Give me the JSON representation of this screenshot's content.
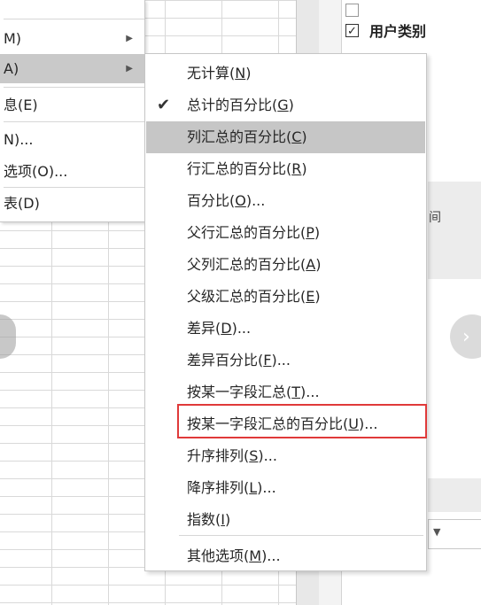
{
  "pane": {
    "fields": [
      {
        "label": "用户类别",
        "checked": true
      }
    ],
    "band_text": "间"
  },
  "parent_menu": {
    "items": [
      {
        "pre": "",
        "key": "",
        "post": "",
        "partial": "M)",
        "arrow": true
      },
      {
        "pre": "",
        "key": "",
        "post": "",
        "partial": "A)",
        "arrow": true,
        "highlighted": true
      },
      {
        "partial": "息(E)"
      },
      {
        "partial": "N)..."
      },
      {
        "partial": "选项(O)..."
      },
      {
        "partial": "表(D)"
      }
    ]
  },
  "submenu": {
    "items": [
      {
        "label_pre": "无计算(",
        "key": "N",
        "label_post": ")"
      },
      {
        "label_pre": "总计的百分比(",
        "key": "G",
        "label_post": ")",
        "checked": true
      },
      {
        "label_pre": "列汇总的百分比(",
        "key": "C",
        "label_post": ")",
        "highlighted": true
      },
      {
        "label_pre": "行汇总的百分比(",
        "key": "R",
        "label_post": ")"
      },
      {
        "label_pre": "百分比(",
        "key": "O",
        "label_post": ")..."
      },
      {
        "label_pre": "父行汇总的百分比(",
        "key": "P",
        "label_post": ")"
      },
      {
        "label_pre": "父列汇总的百分比(",
        "key": "A",
        "label_post": ")"
      },
      {
        "label_pre": "父级汇总的百分比(",
        "key": "E",
        "label_post": ")"
      },
      {
        "label_pre": "差异(",
        "key": "D",
        "label_post": ")..."
      },
      {
        "label_pre": "差异百分比(",
        "key": "F",
        "label_post": ")..."
      },
      {
        "label_pre": "按某一字段汇总(",
        "key": "T",
        "label_post": ")..."
      },
      {
        "label_pre": "按某一字段汇总的百分比(",
        "key": "U",
        "label_post": ")...",
        "boxed": true
      },
      {
        "label_pre": "升序排列(",
        "key": "S",
        "label_post": ")..."
      },
      {
        "label_pre": "降序排列(",
        "key": "L",
        "label_post": ")..."
      },
      {
        "label_pre": "指数(",
        "key": "I",
        "label_post": ")"
      },
      {
        "label_pre": "其他选项(",
        "key": "M",
        "label_post": ")..."
      }
    ]
  },
  "colors": {
    "highlight": "#c6c6c6",
    "red_box": "#e03a3a",
    "grid": "#d9d9d9"
  }
}
